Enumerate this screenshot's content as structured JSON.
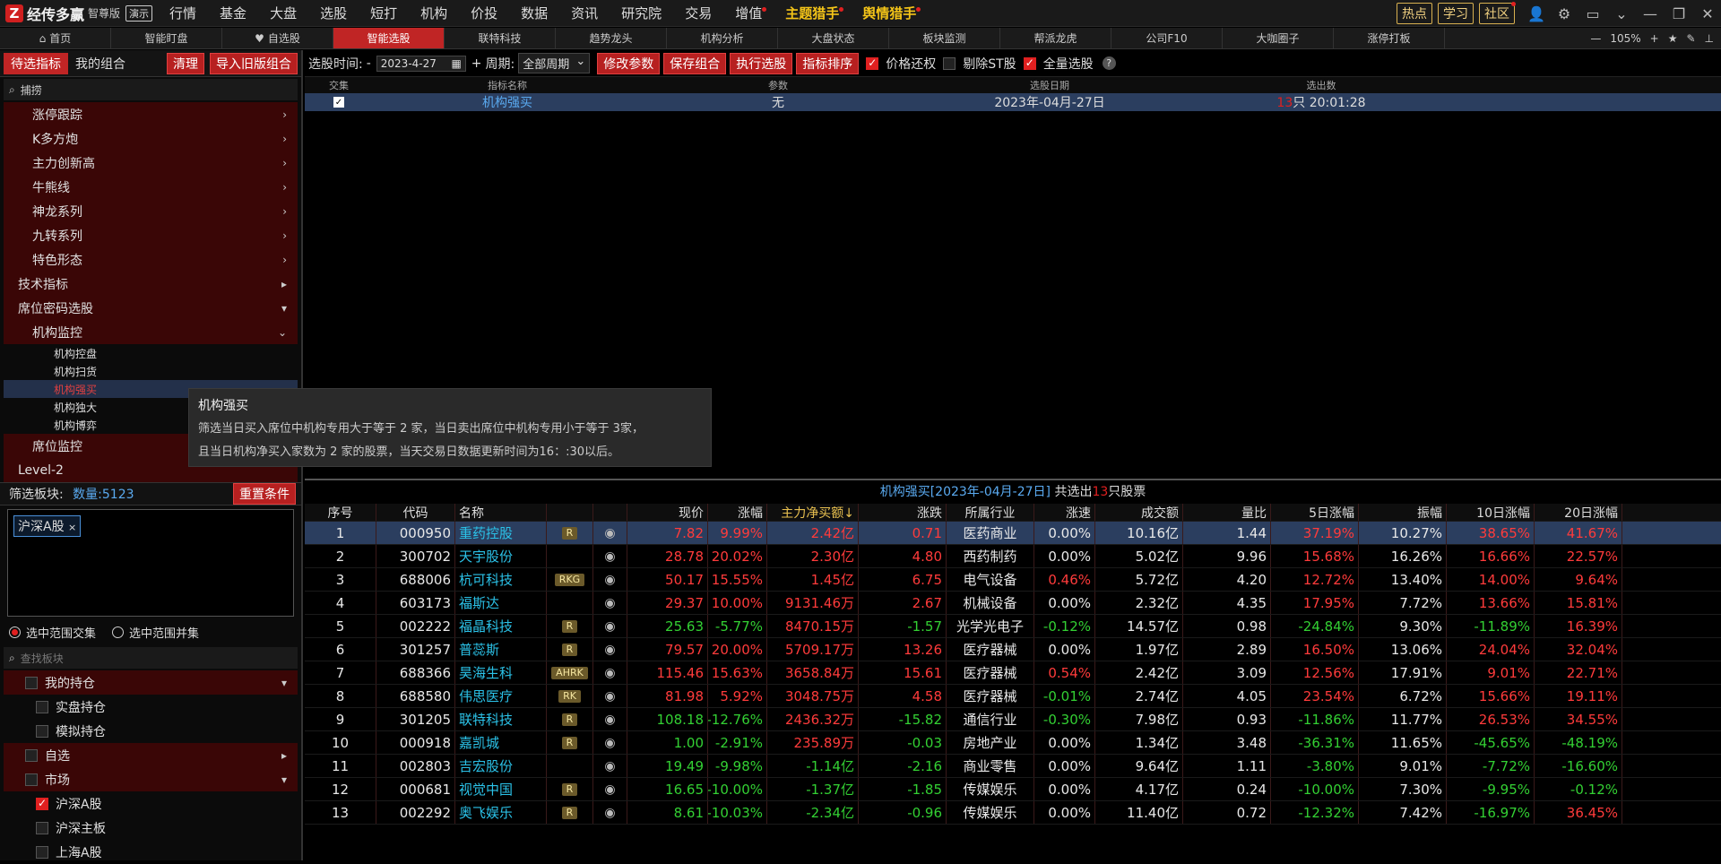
{
  "app": {
    "logo_text": "经传多赢",
    "edition": "智尊版",
    "demo_badge": "演示"
  },
  "top_menu": [
    {
      "label": "行情",
      "dot": false,
      "gold": false
    },
    {
      "label": "基金",
      "dot": false,
      "gold": false
    },
    {
      "label": "大盘",
      "dot": false,
      "gold": false
    },
    {
      "label": "选股",
      "dot": false,
      "gold": false
    },
    {
      "label": "短打",
      "dot": false,
      "gold": false
    },
    {
      "label": "机构",
      "dot": false,
      "gold": false
    },
    {
      "label": "价投",
      "dot": false,
      "gold": false
    },
    {
      "label": "数据",
      "dot": false,
      "gold": false
    },
    {
      "label": "资讯",
      "dot": false,
      "gold": false
    },
    {
      "label": "研究院",
      "dot": false,
      "gold": false
    },
    {
      "label": "交易",
      "dot": false,
      "gold": false
    },
    {
      "label": "增值",
      "dot": true,
      "gold": false
    },
    {
      "label": "主题猎手",
      "dot": true,
      "gold": true
    },
    {
      "label": "舆情猎手",
      "dot": true,
      "gold": true
    }
  ],
  "top_right": {
    "hot": "热点",
    "study": "学习",
    "community": "社区"
  },
  "tabs": [
    {
      "label": "首页",
      "icon": "home-icon",
      "active": false
    },
    {
      "label": "智能盯盘",
      "active": false
    },
    {
      "label": "自选股",
      "icon": "heart-icon",
      "active": false
    },
    {
      "label": "智能选股",
      "active": true
    },
    {
      "label": "联特科技",
      "active": false
    },
    {
      "label": "趋势龙头",
      "active": false
    },
    {
      "label": "机构分析",
      "active": false
    },
    {
      "label": "大盘状态",
      "active": false
    },
    {
      "label": "板块监测",
      "active": false
    },
    {
      "label": "帮派龙虎",
      "active": false
    },
    {
      "label": "公司F10",
      "active": false
    },
    {
      "label": "大咖圈子",
      "active": false
    },
    {
      "label": "涨停打板",
      "active": false
    }
  ],
  "zoom": "105%",
  "left": {
    "tab_pending": "待选指标",
    "tab_mine": "我的组合",
    "clear": "清理",
    "import": "导入旧版组合",
    "search_value": "捕捞",
    "tree": [
      {
        "label": "涨停跟踪",
        "level": 1,
        "arrow": "›"
      },
      {
        "label": "K多方炮",
        "level": 1,
        "arrow": "›"
      },
      {
        "label": "主力创新高",
        "level": 1,
        "arrow": "›"
      },
      {
        "label": "牛熊线",
        "level": 1,
        "arrow": "›"
      },
      {
        "label": "神龙系列",
        "level": 1,
        "arrow": "›"
      },
      {
        "label": "九转系列",
        "level": 1,
        "arrow": "›"
      },
      {
        "label": "特色形态",
        "level": 1,
        "arrow": "›"
      },
      {
        "label": "技术指标",
        "level": 0,
        "arrow": "▸"
      },
      {
        "label": "席位密码选股",
        "level": 0,
        "arrow": "▾"
      },
      {
        "label": "机构监控",
        "level": 1,
        "arrow": "⌄"
      },
      {
        "label": "机构控盘",
        "level": 2,
        "arrow": ""
      },
      {
        "label": "机构扫货",
        "level": 2,
        "arrow": ""
      },
      {
        "label": "机构强买",
        "level": 2,
        "arrow": "",
        "selected": true
      },
      {
        "label": "机构独大",
        "level": 2,
        "arrow": ""
      },
      {
        "label": "机构博弈",
        "level": 2,
        "arrow": ""
      },
      {
        "label": "席位监控",
        "level": 1,
        "arrow": ""
      },
      {
        "label": "Level-2",
        "level": 0,
        "arrow": ""
      }
    ],
    "filter_label": "筛选板块:",
    "filter_count": "数量:5123",
    "reset": "重置条件",
    "tag": "沪深A股",
    "radio_intersect": "选中范围交集",
    "radio_union": "选中范围并集",
    "block_search_placeholder": "查找板块",
    "blocks": [
      {
        "label": "我的持仓",
        "level": 0,
        "checked": false,
        "arrow": "▾"
      },
      {
        "label": "实盘持仓",
        "level": 1,
        "checked": false,
        "arrow": ""
      },
      {
        "label": "模拟持仓",
        "level": 1,
        "checked": false,
        "arrow": ""
      },
      {
        "label": "自选",
        "level": 0,
        "checked": false,
        "arrow": "▸"
      },
      {
        "label": "市场",
        "level": 0,
        "checked": false,
        "arrow": "▾"
      },
      {
        "label": "沪深A股",
        "level": 1,
        "checked": true,
        "arrow": ""
      },
      {
        "label": "沪深主板",
        "level": 1,
        "checked": false,
        "arrow": ""
      },
      {
        "label": "上海A股",
        "level": 1,
        "checked": false,
        "arrow": ""
      }
    ]
  },
  "toolbar": {
    "time_label": "选股时间:",
    "time_dash": "-",
    "date": "2023-4-27",
    "plus": "+",
    "period_label": "周期:",
    "period": "全部周期",
    "modify": "修改参数",
    "save": "保存组合",
    "execute": "执行选股",
    "sort": "指标排序",
    "price_adjust": "价格还权",
    "exclude_st": "剔除ST股",
    "full_select": "全量选股"
  },
  "indicator_table": {
    "headers": [
      "交集",
      "指标名称",
      "参数",
      "选股日期",
      "选出数"
    ],
    "row": {
      "name": "机构强买",
      "param": "无",
      "date": "2023年-04月-27日",
      "count": "13",
      "count_suffix": "只 20:01:28"
    }
  },
  "tooltip": {
    "title": "机构强买",
    "line1": "筛选当日买入席位中机构专用大于等于 2 家，当日卖出席位中机构专用小于等于 3家，",
    "line2": "且当日机构净买入家数为 2 家的股票，当天交易日数据更新时间为16：:30以后。"
  },
  "result": {
    "prefix": "机构强买[2023年-04月-27日]",
    "mid": " 共选出",
    "count": "13",
    "suffix": "只股票"
  },
  "grid": {
    "headers": [
      "序号",
      "代码",
      "名称",
      "",
      "",
      "现价",
      "涨幅",
      "主力净买额↓",
      "涨跌",
      "所属行业",
      "涨速",
      "成交额",
      "量比",
      "5日涨幅",
      "振幅",
      "10日涨幅",
      "20日涨幅"
    ],
    "rows": [
      {
        "no": "1",
        "code": "000950",
        "name": "重药控股",
        "badge": "R",
        "price": "7.82",
        "chg": "9.99%",
        "net": "2.42亿",
        "diff": "0.71",
        "ind": "医药商业",
        "spd": "0.00%",
        "amt": "10.16亿",
        "vr": "1.44",
        "d5": "37.19%",
        "amp": "10.27%",
        "d10": "38.65%",
        "d20": "41.67%",
        "dir": "up",
        "spd_dir": "wh",
        "d5_dir": "up",
        "d10_dir": "up",
        "d20_dir": "up"
      },
      {
        "no": "2",
        "code": "300702",
        "name": "天宇股份",
        "badge": "",
        "price": "28.78",
        "chg": "20.02%",
        "net": "2.30亿",
        "diff": "4.80",
        "ind": "西药制药",
        "spd": "0.00%",
        "amt": "5.02亿",
        "vr": "9.96",
        "d5": "15.68%",
        "amp": "16.26%",
        "d10": "16.66%",
        "d20": "22.57%",
        "dir": "up",
        "spd_dir": "wh",
        "d5_dir": "up",
        "d10_dir": "up",
        "d20_dir": "up"
      },
      {
        "no": "3",
        "code": "688006",
        "name": "杭可科技",
        "badge": "RKG",
        "price": "50.17",
        "chg": "15.55%",
        "net": "1.45亿",
        "diff": "6.75",
        "ind": "电气设备",
        "spd": "0.46%",
        "amt": "5.72亿",
        "vr": "4.20",
        "d5": "12.72%",
        "amp": "13.40%",
        "d10": "14.00%",
        "d20": "9.64%",
        "dir": "up",
        "spd_dir": "up",
        "d5_dir": "up",
        "d10_dir": "up",
        "d20_dir": "up"
      },
      {
        "no": "4",
        "code": "603173",
        "name": "福斯达",
        "badge": "",
        "price": "29.37",
        "chg": "10.00%",
        "net": "9131.46万",
        "diff": "2.67",
        "ind": "机械设备",
        "spd": "0.00%",
        "amt": "2.32亿",
        "vr": "4.35",
        "d5": "17.95%",
        "amp": "7.72%",
        "d10": "13.66%",
        "d20": "15.81%",
        "dir": "up",
        "spd_dir": "wh",
        "d5_dir": "up",
        "d10_dir": "up",
        "d20_dir": "up"
      },
      {
        "no": "5",
        "code": "002222",
        "name": "福晶科技",
        "badge": "R",
        "price": "25.63",
        "chg": "-5.77%",
        "net": "8470.15万",
        "diff": "-1.57",
        "ind": "光学光电子",
        "spd": "-0.12%",
        "amt": "14.57亿",
        "vr": "0.98",
        "d5": "-24.84%",
        "amp": "9.30%",
        "d10": "-11.89%",
        "d20": "16.39%",
        "dir": "dn",
        "spd_dir": "dn",
        "d5_dir": "dn",
        "d10_dir": "dn",
        "d20_dir": "up"
      },
      {
        "no": "6",
        "code": "301257",
        "name": "普蕊斯",
        "badge": "R",
        "price": "79.57",
        "chg": "20.00%",
        "net": "5709.17万",
        "diff": "13.26",
        "ind": "医疗器械",
        "spd": "0.00%",
        "amt": "1.97亿",
        "vr": "2.89",
        "d5": "16.50%",
        "amp": "13.06%",
        "d10": "24.04%",
        "d20": "32.04%",
        "dir": "up",
        "spd_dir": "wh",
        "d5_dir": "up",
        "d10_dir": "up",
        "d20_dir": "up"
      },
      {
        "no": "7",
        "code": "688366",
        "name": "昊海生科",
        "badge": "AHRK",
        "price": "115.46",
        "chg": "15.63%",
        "net": "3658.84万",
        "diff": "15.61",
        "ind": "医疗器械",
        "spd": "0.54%",
        "amt": "2.42亿",
        "vr": "3.09",
        "d5": "12.56%",
        "amp": "17.91%",
        "d10": "9.01%",
        "d20": "22.71%",
        "dir": "up",
        "spd_dir": "up",
        "d5_dir": "up",
        "d10_dir": "up",
        "d20_dir": "up"
      },
      {
        "no": "8",
        "code": "688580",
        "name": "伟思医疗",
        "badge": "RK",
        "price": "81.98",
        "chg": "5.92%",
        "net": "3048.75万",
        "diff": "4.58",
        "ind": "医疗器械",
        "spd": "-0.01%",
        "amt": "2.74亿",
        "vr": "4.05",
        "d5": "23.54%",
        "amp": "6.72%",
        "d10": "15.66%",
        "d20": "19.11%",
        "dir": "up",
        "spd_dir": "dn",
        "d5_dir": "up",
        "d10_dir": "up",
        "d20_dir": "up"
      },
      {
        "no": "9",
        "code": "301205",
        "name": "联特科技",
        "badge": "R",
        "price": "108.18",
        "chg": "-12.76%",
        "net": "2436.32万",
        "diff": "-15.82",
        "ind": "通信行业",
        "spd": "-0.30%",
        "amt": "7.98亿",
        "vr": "0.93",
        "d5": "-11.86%",
        "amp": "11.77%",
        "d10": "26.53%",
        "d20": "34.55%",
        "dir": "dn",
        "spd_dir": "dn",
        "d5_dir": "dn",
        "d10_dir": "up",
        "d20_dir": "up"
      },
      {
        "no": "10",
        "code": "000918",
        "name": "嘉凯城",
        "badge": "R",
        "price": "1.00",
        "chg": "-2.91%",
        "net": "235.89万",
        "diff": "-0.03",
        "ind": "房地产业",
        "spd": "0.00%",
        "amt": "1.34亿",
        "vr": "3.48",
        "d5": "-36.31%",
        "amp": "11.65%",
        "d10": "-45.65%",
        "d20": "-48.19%",
        "dir": "dn",
        "spd_dir": "wh",
        "d5_dir": "dn",
        "d10_dir": "dn",
        "d20_dir": "dn"
      },
      {
        "no": "11",
        "code": "002803",
        "name": "吉宏股份",
        "badge": "",
        "price": "19.49",
        "chg": "-9.98%",
        "net": "-1.14亿",
        "diff": "-2.16",
        "ind": "商业零售",
        "spd": "0.00%",
        "amt": "9.64亿",
        "vr": "1.11",
        "d5": "-3.80%",
        "amp": "9.01%",
        "d10": "-7.72%",
        "d20": "-16.60%",
        "dir": "dn",
        "spd_dir": "wh",
        "d5_dir": "dn",
        "d10_dir": "dn",
        "d20_dir": "dn"
      },
      {
        "no": "12",
        "code": "000681",
        "name": "视觉中国",
        "badge": "R",
        "price": "16.65",
        "chg": "-10.00%",
        "net": "-1.37亿",
        "diff": "-1.85",
        "ind": "传媒娱乐",
        "spd": "0.00%",
        "amt": "4.17亿",
        "vr": "0.24",
        "d5": "-10.00%",
        "amp": "7.30%",
        "d10": "-9.95%",
        "d20": "-0.12%",
        "dir": "dn",
        "spd_dir": "wh",
        "d5_dir": "dn",
        "d10_dir": "dn",
        "d20_dir": "dn"
      },
      {
        "no": "13",
        "code": "002292",
        "name": "奥飞娱乐",
        "badge": "R",
        "price": "8.61",
        "chg": "-10.03%",
        "net": "-2.34亿",
        "diff": "-0.96",
        "ind": "传媒娱乐",
        "spd": "0.00%",
        "amt": "11.40亿",
        "vr": "0.72",
        "d5": "-12.32%",
        "amp": "7.42%",
        "d10": "-16.97%",
        "d20": "36.45%",
        "dir": "dn",
        "spd_dir": "wh",
        "d5_dir": "dn",
        "d10_dir": "dn",
        "d20_dir": "up"
      }
    ]
  }
}
